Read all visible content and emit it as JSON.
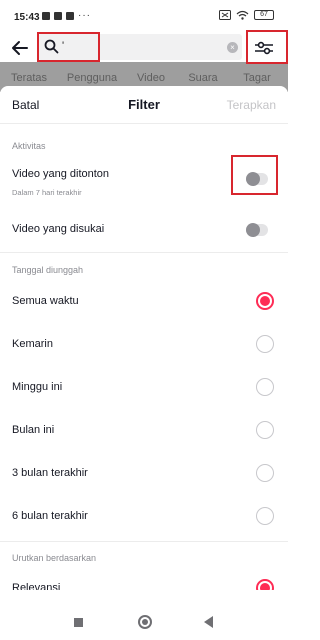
{
  "status_bar": {
    "time": "15:43",
    "dots": "···",
    "battery": "67"
  },
  "search": {
    "value": "'"
  },
  "tabs": [
    {
      "label": "Teratas"
    },
    {
      "label": "Pengguna"
    },
    {
      "label": "Video"
    },
    {
      "label": "Suara"
    },
    {
      "label": "Tagar"
    }
  ],
  "sheet": {
    "cancel_label": "Batal",
    "title": "Filter",
    "apply_label": "Terapkan",
    "activity_section": "Aktivitas",
    "watched_label": "Video yang ditonton",
    "watched_sub": "Dalam 7 hari terakhir",
    "liked_label": "Video yang disukai",
    "date_section": "Tanggal diunggah",
    "date_options": [
      {
        "label": "Semua waktu",
        "selected": true
      },
      {
        "label": "Kemarin",
        "selected": false
      },
      {
        "label": "Minggu ini",
        "selected": false
      },
      {
        "label": "Bulan ini",
        "selected": false
      },
      {
        "label": "3 bulan terakhir",
        "selected": false
      },
      {
        "label": "6 bulan terakhir",
        "selected": false
      }
    ],
    "sort_section": "Urutkan berdasarkan",
    "sort_first": {
      "label": "Relevansi",
      "selected": true
    }
  },
  "colors": {
    "accent": "#fe2c55",
    "highlight": "#d8262e"
  }
}
